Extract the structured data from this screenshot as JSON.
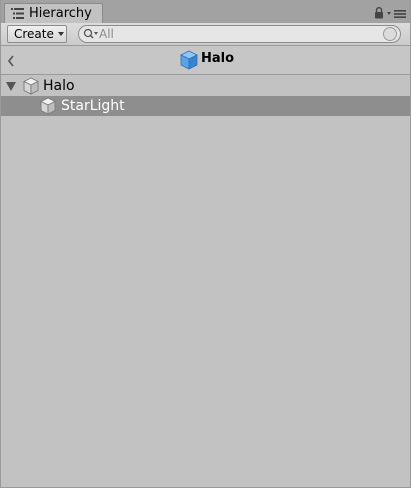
{
  "window": {
    "tab_label": "Hierarchy",
    "tab_icon": "hierarchy-list-icon",
    "lock_icon": "lock-icon",
    "menu_icon": "panel-menu-icon"
  },
  "toolbar": {
    "create_label": "Create",
    "search": {
      "value": "",
      "placeholder": "All"
    }
  },
  "scene_header": {
    "title": "Halo",
    "back_icon": "chevron-left-icon",
    "prefab_icon": "prefab-cube-icon",
    "prefab_color": "#5aa3e8"
  },
  "tree": {
    "items": [
      {
        "label": "Halo",
        "expanded": true,
        "depth": 0,
        "selected": false,
        "icon": "gameobject-cube-icon"
      },
      {
        "label": "StarLight",
        "expanded": false,
        "depth": 1,
        "selected": true,
        "icon": "gameobject-cube-icon"
      }
    ]
  },
  "colors": {
    "panel_bg": "#c2c2c2",
    "selection_bg": "#8e8e8e",
    "selection_text": "#ffffff"
  }
}
